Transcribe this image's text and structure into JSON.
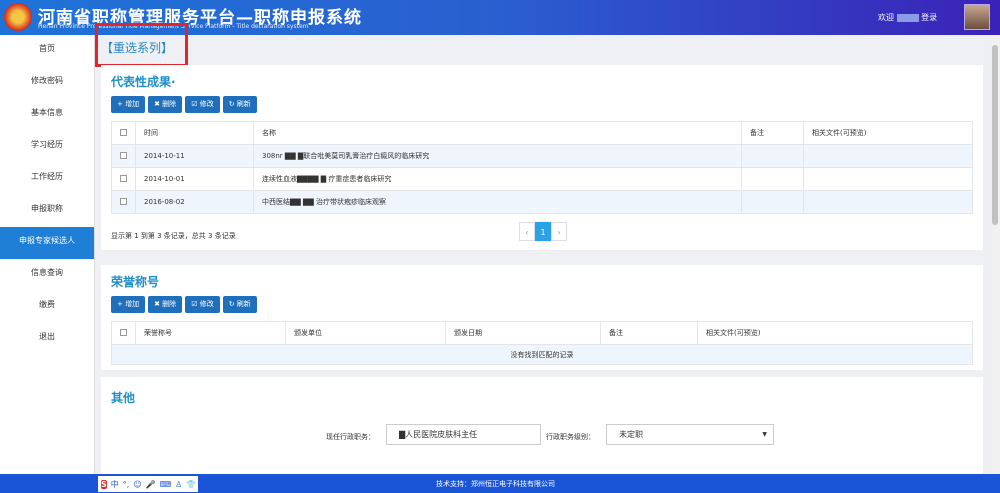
{
  "header": {
    "title": "河南省职称管理服务平台—职称申报系统",
    "subtitle": "Henan Province Professional Title Management Service Platform - Title declaration system",
    "welcome": "欢迎",
    "logout": "登录"
  },
  "sidebar": {
    "items": [
      "首页",
      "修改密码",
      "基本信息",
      "学习经历",
      "工作经历",
      "申报职称",
      "申报专家候选人",
      "信息查询",
      "缴费",
      "退出"
    ],
    "active": 6
  },
  "breadcrumb": "【重选系列】",
  "achievements": {
    "title": "代表性成果·",
    "buttons": [
      "+ 增加",
      "✖ 删除",
      "☑ 修改",
      "↻ 刷新"
    ],
    "columns": [
      "时间",
      "名称",
      "备注",
      "相关文件(可预览)"
    ],
    "rows": [
      [
        "2014-10-11",
        "308nr ▇▇ ▇联合吡美莫司乳膏治疗白癜风的临床研究",
        "",
        ""
      ],
      [
        "2014-10-01",
        "连续性血液▇▇▇▇ ▇ 疗重症患者临床研究",
        "",
        ""
      ],
      [
        "2016-08-02",
        "中西医结▇▇ ▇▇ 治疗带状疱疹临床观察",
        "",
        ""
      ]
    ],
    "summary": "显示第 1 到第 3 条记录，总共 3 条记录",
    "pager": [
      "‹",
      "1",
      "›"
    ]
  },
  "honors": {
    "title": "荣誉称号",
    "buttons": [
      "+ 增加",
      "✖ 删除",
      "☑ 修改",
      "↻ 刷新"
    ],
    "columns": [
      "荣誉称号",
      "颁发单位",
      "颁发日期",
      "备注",
      "相关文件(可预览)"
    ],
    "empty": "没有找到匹配的记录"
  },
  "other": {
    "title": "其他",
    "position_label": "现任行政职务：",
    "position_value": "▇人民医院皮肤科主任",
    "level_label": "行政职务级别：",
    "level_value": "未定职"
  },
  "footer": {
    "support": "技术支持：郑州恒正电子科技有限公司",
    "ime": [
      "S",
      "中",
      "°,",
      "☺",
      "🎤",
      "⌨",
      "♙",
      "👕",
      "▦"
    ]
  }
}
